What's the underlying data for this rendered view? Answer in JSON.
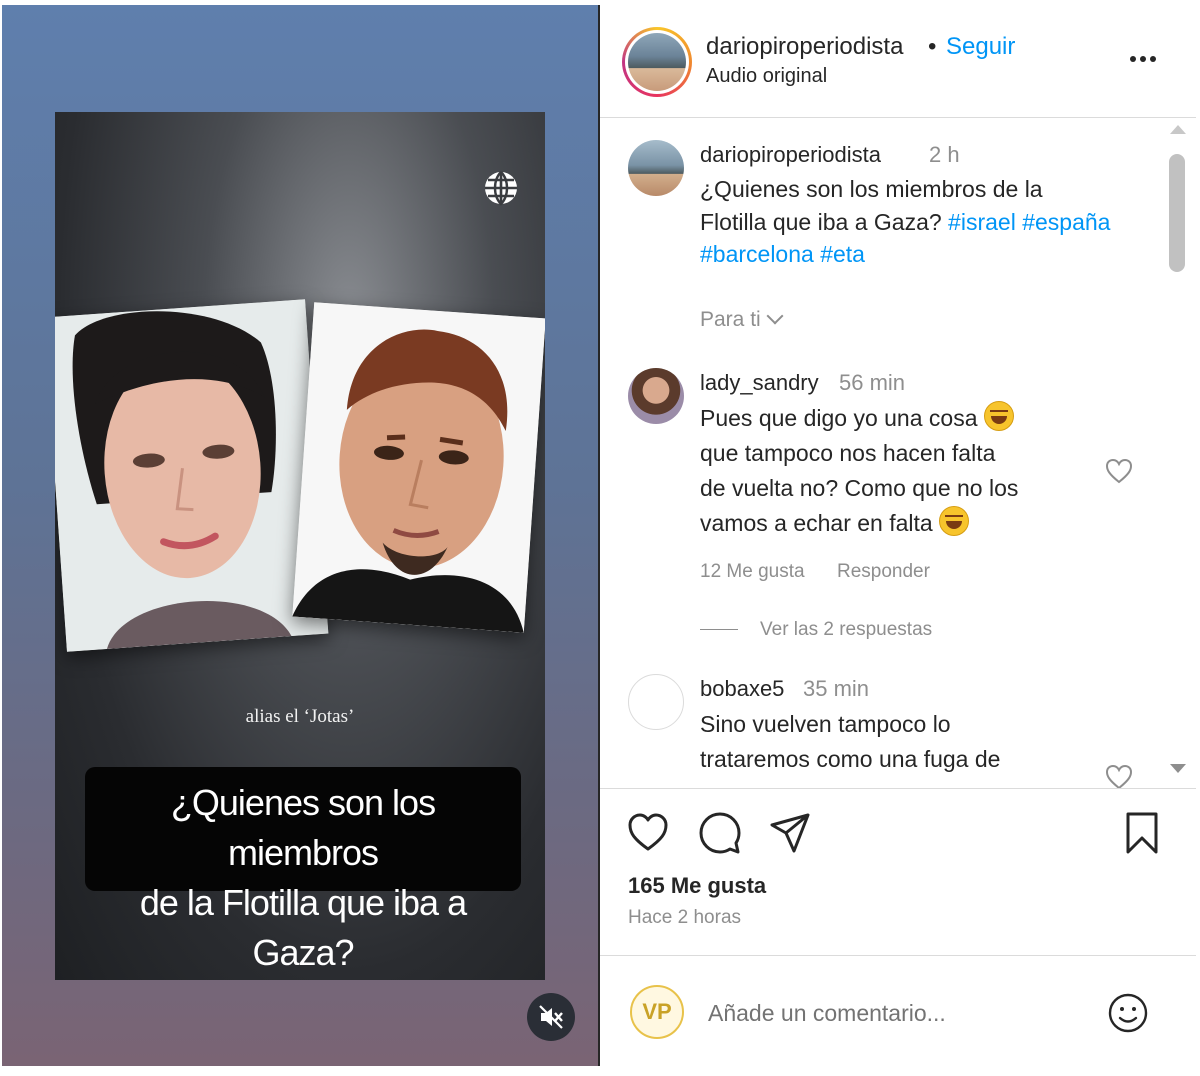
{
  "video": {
    "alias_text": "alias el ‘Jotas’",
    "caption_line1": "¿Quienes son los miembros",
    "caption_line2": "de la Flotilla que iba a Gaza?"
  },
  "post_header": {
    "username": "dariopiroperiodista",
    "separator": "•",
    "follow_label": "Seguir",
    "audio": "Audio original"
  },
  "caption": {
    "username": "dariopiroperiodista",
    "time": "2 h",
    "text_line1": "¿Quienes son los miembros de la",
    "text_line2": "Flotilla que iba a Gaza?",
    "hashtags": [
      "#israel",
      "#españa",
      "#barcelona",
      "#eta"
    ]
  },
  "filter": {
    "label": "Para ti"
  },
  "comments": [
    {
      "username": "lady_sandry",
      "time": "56 min",
      "line1": "Pues que digo yo una cosa",
      "line2": "que tampoco nos hacen falta",
      "line3": "de vuelta no? Como que no los",
      "line4": "vamos a echar en falta",
      "likes": "12 Me gusta",
      "reply_label": "Responder",
      "view_replies": "Ver las 2 respuestas"
    },
    {
      "username": "bobaxe5",
      "time": "35 min",
      "line1": "Sino vuelven tampoco lo",
      "line2": "trataremos como una fuga de"
    }
  ],
  "footer": {
    "likes_count": "165 Me gusta",
    "posted": "Hace 2 horas",
    "my_avatar_initials": "VP",
    "comment_placeholder": "Añade un comentario..."
  },
  "icons": [
    "globe-icon",
    "mute-icon",
    "more-icon",
    "heart-icon",
    "comment-icon",
    "share-icon",
    "bookmark-icon",
    "emoji-icon"
  ],
  "colors": {
    "link": "#0095f6",
    "muted": "#8e8e8e",
    "text": "#262626"
  }
}
